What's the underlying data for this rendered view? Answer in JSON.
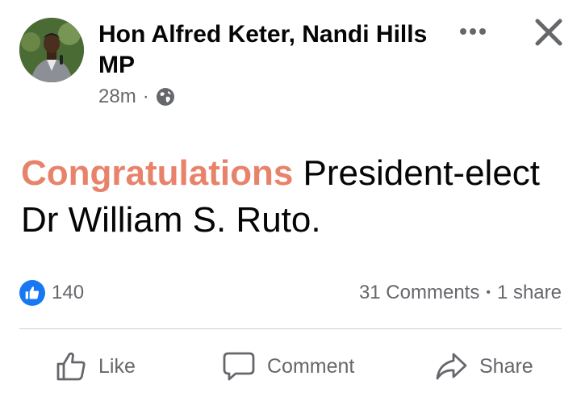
{
  "post": {
    "author": "Hon Alfred Keter, Nandi Hills MP",
    "time": "28m",
    "separator": "·",
    "audience_icon": "globe-icon",
    "text_highlight": "Congratulations",
    "text_line1_rest": " President-elect",
    "text_line2": "Dr William S. Ruto.",
    "colors": {
      "highlight": "#e8826a",
      "like_blue": "#1877f2",
      "meta_gray": "#65676b"
    }
  },
  "reactions": {
    "icon": "thumbs-up-icon",
    "count": "140"
  },
  "stats": {
    "comments": "31 Comments",
    "bullet": "•",
    "shares": "1 share"
  },
  "actions": {
    "like": "Like",
    "comment": "Comment",
    "share": "Share"
  }
}
